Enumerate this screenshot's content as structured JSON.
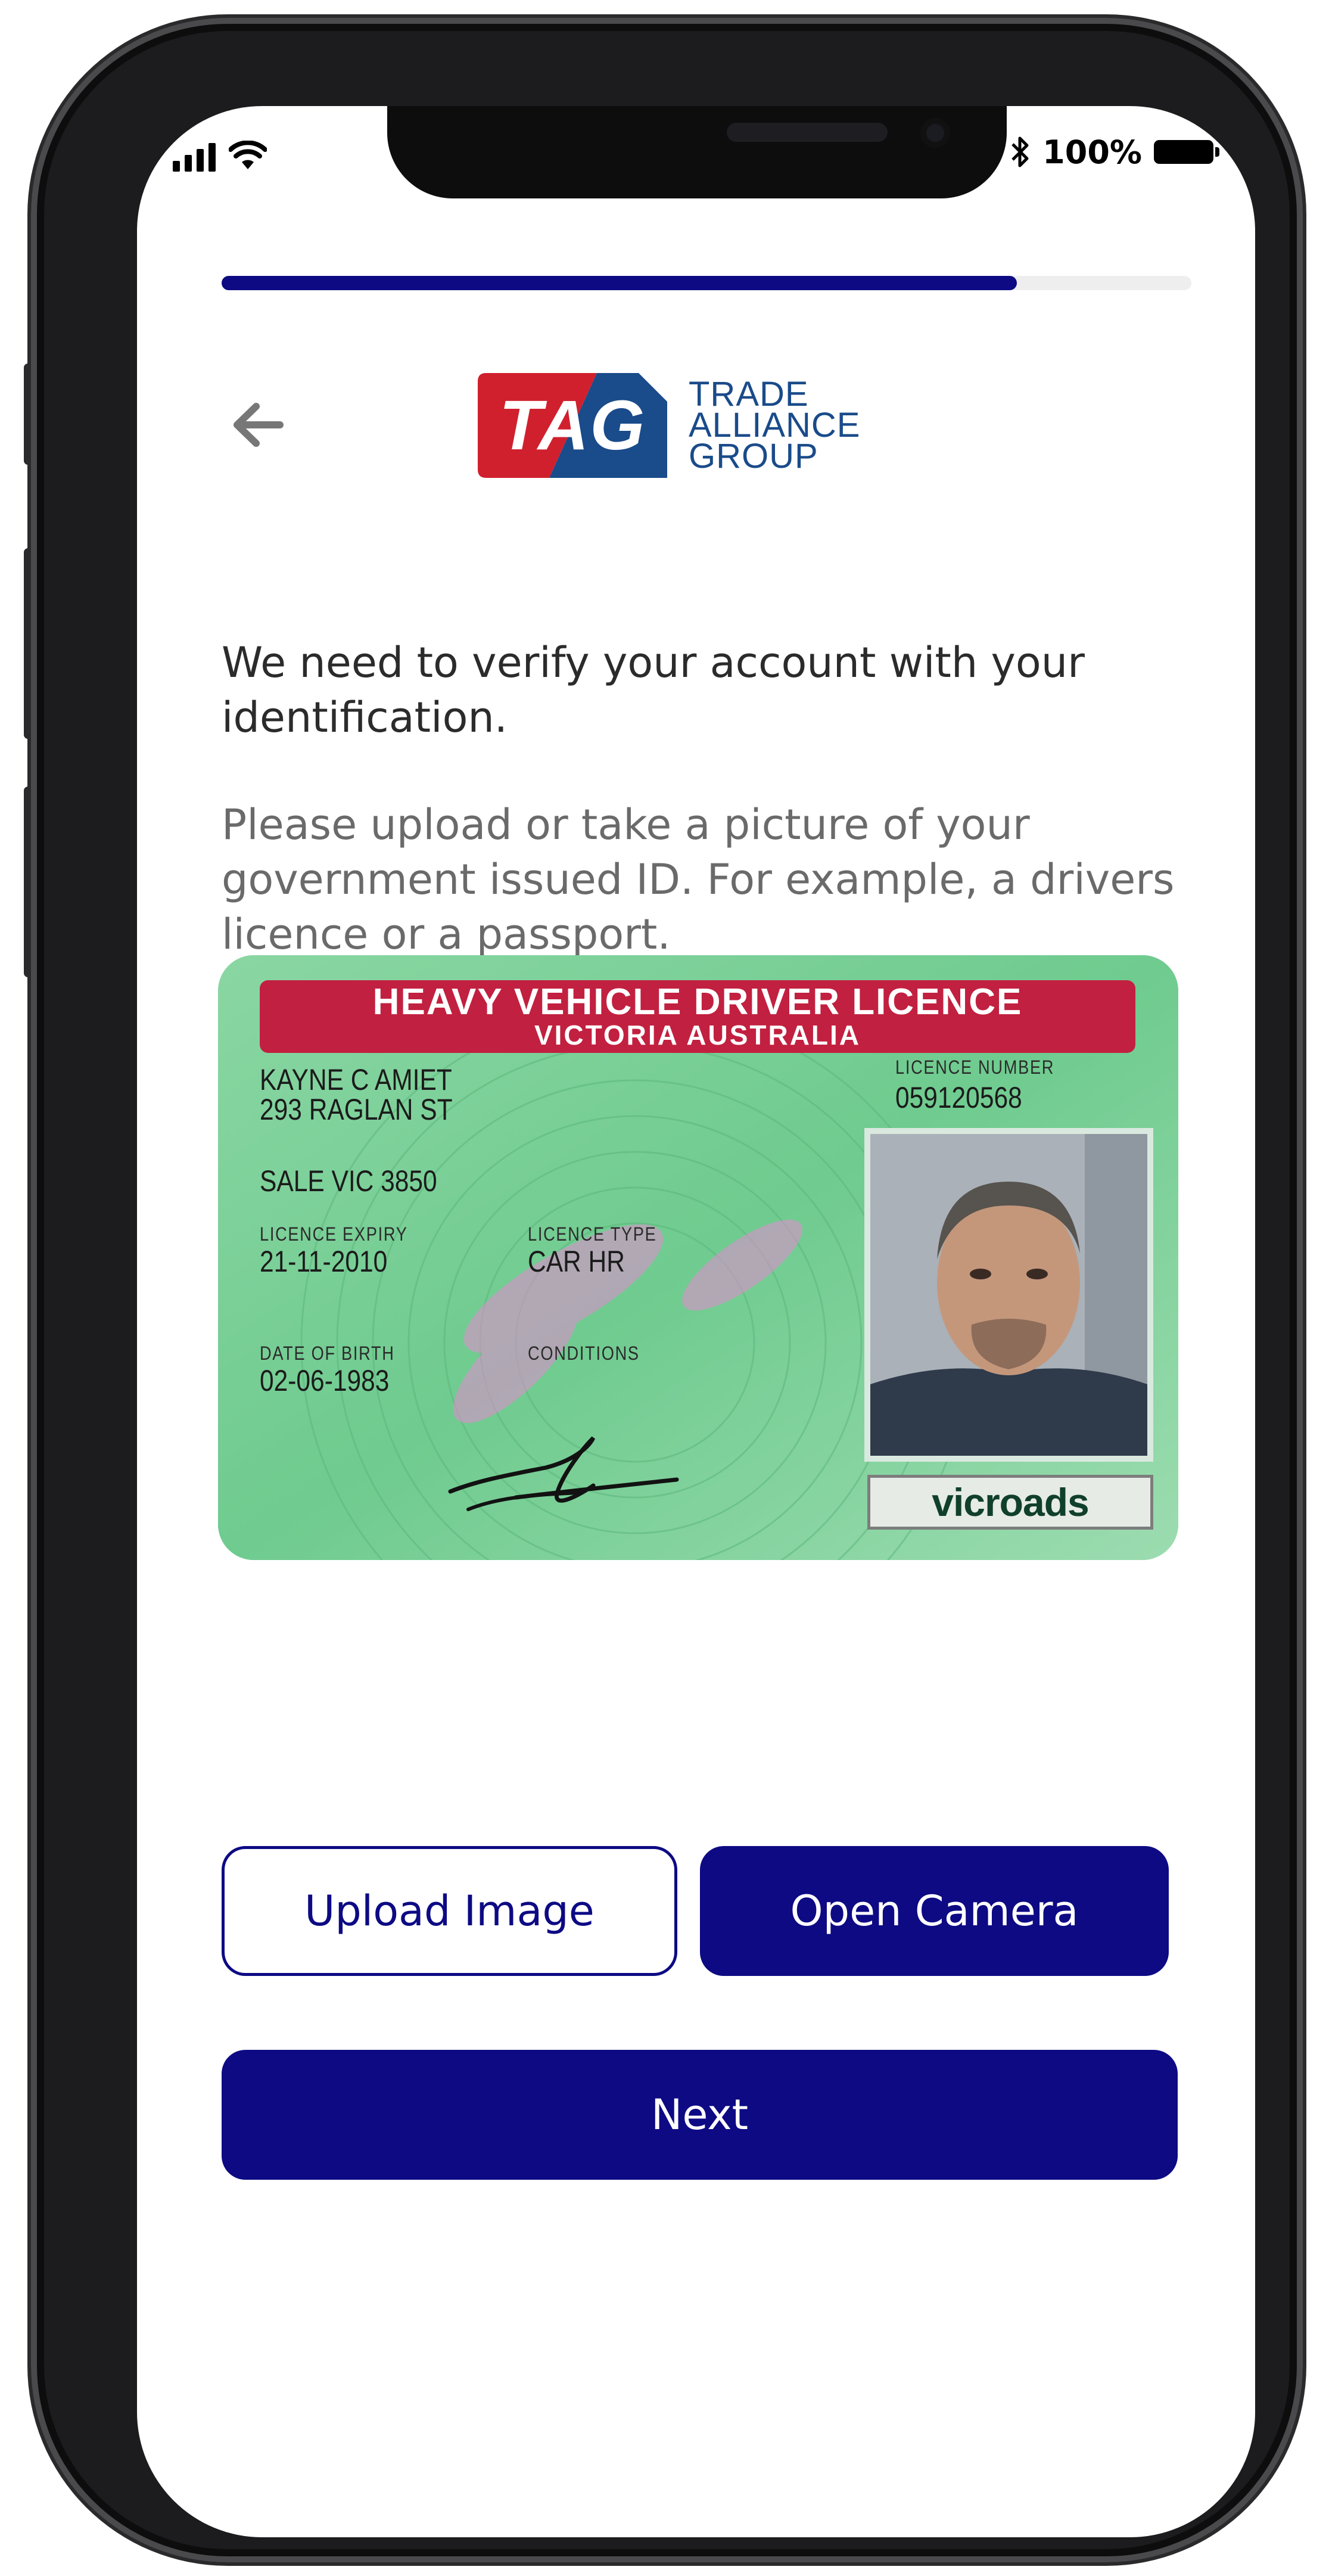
{
  "status_bar": {
    "battery_percent": "100%",
    "icons": [
      "signal-icon",
      "wifi-icon",
      "bluetooth-icon",
      "battery-icon"
    ]
  },
  "progress": {
    "value": 0.82
  },
  "header": {
    "back_icon": "arrow-left-icon",
    "logo_badge": "TAG",
    "logo_line1": "TRADE",
    "logo_line2": "ALLIANCE",
    "logo_line3": "GROUP"
  },
  "content": {
    "intro": "We need to verify your account with your identification.",
    "instructions": "Please upload or take a picture of your government issued ID. For example, a drivers licence or a passport."
  },
  "licence": {
    "title": "HEAVY VEHICLE DRIVER LICENCE",
    "subtitle": "VICTORIA AUSTRALIA",
    "name": "KAYNE C AMIET",
    "address1": "293 RAGLAN ST",
    "address2": "SALE VIC 3850",
    "licence_number_label": "LICENCE NUMBER",
    "licence_number": "059120568",
    "expiry_label": "LICENCE EXPIRY",
    "expiry": "21-11-2010",
    "type_label": "LICENCE TYPE",
    "type": "CAR HR",
    "dob_label": "DATE OF BIRTH",
    "dob": "02-06-1983",
    "conditions_label": "CONDITIONS",
    "issuer": "vicroads"
  },
  "actions": {
    "upload": "Upload Image",
    "camera": "Open Camera",
    "next": "Next"
  },
  "colors": {
    "primary": "#0d0a84",
    "logo_red": "#d0202e",
    "logo_blue": "#1a4b8a"
  }
}
